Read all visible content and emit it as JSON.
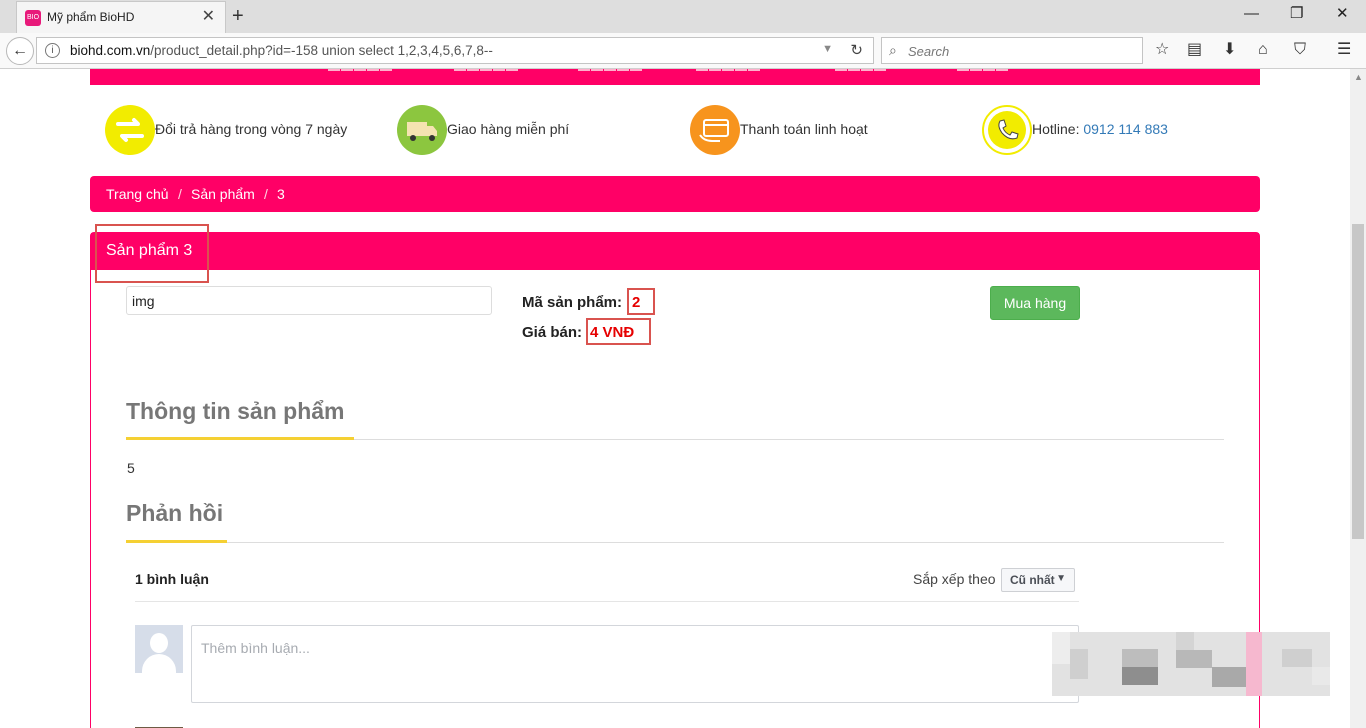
{
  "browser": {
    "tab_title": "Mỹ phẩm BioHD",
    "favicon_text": "BIO",
    "url_domain": "biohd.com.vn",
    "url_rest": "/product_detail.php?id=-158 union select 1,2,3,4,5,6,7,8--",
    "search_placeholder": "Search"
  },
  "features": [
    {
      "label": "Đổi trả hàng trong vòng 7 ngày",
      "icon": "exchange-arrows-icon",
      "color": "#f2ec00"
    },
    {
      "label": "Giao hàng miễn phí",
      "icon": "delivery-truck-icon",
      "color": "#8cc63f"
    },
    {
      "label": "Thanh toán linh hoạt",
      "icon": "payment-card-icon",
      "color": "#f7941d"
    },
    {
      "label": "Hotline: ",
      "value": "0912 114 883",
      "icon": "phone-icon",
      "color": "#f2ec00"
    }
  ],
  "breadcrumb": [
    "Trang chủ",
    "Sản phẩm",
    "3"
  ],
  "product": {
    "title": "Sản phẩm 3",
    "image_alt": "img",
    "code_label": "Mã sản phẩm:",
    "code_value": "2",
    "price_label": "Giá bán:",
    "price_value": "4 VNĐ",
    "buy_label": "Mua hàng",
    "info_heading": "Thông tin sản phẩm",
    "description": "5",
    "feedback_heading": "Phản hồi"
  },
  "comments": {
    "count_label": "1 bình luận",
    "sort_label": "Sắp xếp theo",
    "sort_value": "Cũ nhất",
    "input_placeholder": "Thêm bình luận..."
  },
  "colors": {
    "brand": "#ff0066",
    "button": "#5cb85c",
    "highlight": "#e60000",
    "accent_line": "#f5d033"
  }
}
